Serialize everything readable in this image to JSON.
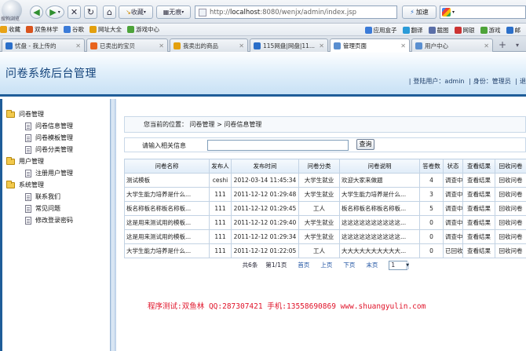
{
  "browser": {
    "logo_label": "搜狗浏览",
    "back_icon": "back-arrow-icon",
    "forward_icon": "forward-arrow-icon",
    "stop_icon": "close-icon",
    "refresh_icon": "refresh-icon",
    "home_icon": "home-icon",
    "favorites_label": "收藏",
    "no_trace_label": "无痕",
    "address_prefix": "http://",
    "address_host": "localhost",
    "address_rest": ":8080/wenjx/admin/index.jsp",
    "speed_label": "加速",
    "bookmarks": [
      {
        "label": "收藏",
        "color": "#e8a317"
      },
      {
        "label": "双鱼林学",
        "color": "#d9541e"
      },
      {
        "label": "谷歌",
        "color": "#3b7bd8"
      },
      {
        "label": "网址大全",
        "color": "#e3a00e"
      },
      {
        "label": "游戏中心",
        "color": "#4da33a"
      }
    ],
    "bookmarks_right": [
      {
        "label": "应用盒子",
        "color": "#3b7bd8"
      },
      {
        "label": "翻译",
        "color": "#2b9bd8"
      },
      {
        "label": "截图",
        "color": "#5a6fa8"
      },
      {
        "label": "网银",
        "color": "#c33"
      },
      {
        "label": "游戏",
        "color": "#4da33a"
      },
      {
        "label": "邮",
        "color": "#2b6fc9"
      }
    ],
    "tabs": [
      {
        "label": "忧盘 - 我上传的",
        "color": "#2b6fc9"
      },
      {
        "label": "已卖出的宝贝",
        "color": "#e8641e"
      },
      {
        "label": "我卖出的商品",
        "color": "#e3a00e"
      },
      {
        "label": "115网盘|网盘|11...",
        "color": "#2b6fc9"
      },
      {
        "label": "管理页面",
        "color": "#5a8fd0"
      },
      {
        "label": "用户中心",
        "color": "#5a8fd0"
      }
    ]
  },
  "header": {
    "title": "问卷系统后台管理",
    "login_label": "登陆用户：",
    "login_user": "admin",
    "role_label": "身份：",
    "role_value": "管理员",
    "trailing": "退"
  },
  "sidebar": {
    "groups": [
      {
        "label": "问卷管理",
        "items": [
          "问卷信息管理",
          "问卷模板管理",
          "问卷分类管理"
        ]
      },
      {
        "label": "用户管理",
        "items": [
          "注册用户管理"
        ]
      },
      {
        "label": "系统管理",
        "items": [
          "联系我们",
          "常见问题",
          "修改登录密码"
        ]
      }
    ]
  },
  "main": {
    "breadcrumb": "您当前的位置： 问卷管理 > 问卷信息管理",
    "search_label": "请输入相关信息",
    "search_value": "",
    "search_button": "查询",
    "columns": [
      "问卷名称",
      "发布人",
      "发布时间",
      "问卷分类",
      "问卷说明",
      "答卷数",
      "状态",
      "查看结果",
      "回收问卷"
    ],
    "rows": [
      [
        "测试模板",
        "ceshi",
        "2012-03-14 11:45:34",
        "大学生就业",
        "欢迎大家来做题",
        "4",
        "调查中",
        "查看结果",
        "回收问卷"
      ],
      [
        "大学生能力培养是什么...",
        "111",
        "2011-12-12 01:29:48",
        "大学生就业",
        "大学生能力培养是什么...",
        "3",
        "调查中",
        "查看结果",
        "回收问卷"
      ],
      [
        "板名称板名称板名称板...",
        "111",
        "2011-12-12 01:29:45",
        "工人",
        "板名称板名称板名称板...",
        "5",
        "调查中",
        "查看结果",
        "回收问卷"
      ],
      [
        "这是用来测试用的模板...",
        "111",
        "2011-12-12 01:29:40",
        "大学生就业",
        "这这这这这这这这这这...",
        "0",
        "调查中",
        "查看结果",
        "回收问卷"
      ],
      [
        "这是用来测试用的模板...",
        "111",
        "2011-12-12 01:29:34",
        "大学生就业",
        "这这这这这这这这这这...",
        "0",
        "调查中",
        "查看结果",
        "回收问卷"
      ],
      [
        "大学生能力培养是什么...",
        "111",
        "2011-12-12 01:22:05",
        "工人",
        "大大大大大大大大大大...",
        "0",
        "已回收",
        "查看结果",
        "回收问卷"
      ]
    ],
    "pager": {
      "info": "共6条",
      "page_info": "第1/1页",
      "first": "首页",
      "prev": "上页",
      "next": "下页",
      "last": "末页",
      "current": "1"
    }
  },
  "credit": "程序测试:双鱼林 QQ:287307421 手机:13558690869 www.shuangyulin.com"
}
